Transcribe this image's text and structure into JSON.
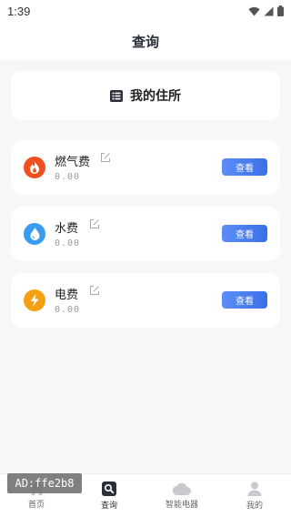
{
  "status_bar": {
    "time": "1:39",
    "icons": [
      "wifi-icon",
      "signal-icon",
      "battery-icon"
    ]
  },
  "header": {
    "title": "查询"
  },
  "residence": {
    "label": "我的住所",
    "icon": "list-icon"
  },
  "utilities": [
    {
      "name": "燃气费",
      "value": "0.00",
      "button_label": "查看",
      "icon": "flame-icon",
      "color": "#f0501e"
    },
    {
      "name": "水费",
      "value": "0.00",
      "button_label": "查看",
      "icon": "water-drop-icon",
      "color": "#3a9cf0"
    },
    {
      "name": "电费",
      "value": "0.00",
      "button_label": "查看",
      "icon": "lightning-icon",
      "color": "#f5a011"
    }
  ],
  "tab_bar": {
    "items": [
      {
        "label": "首页",
        "icon": "home-icon",
        "active": false
      },
      {
        "label": "查询",
        "icon": "search-icon",
        "active": true
      },
      {
        "label": "智能电器",
        "icon": "cloud-icon",
        "active": false
      },
      {
        "label": "我的",
        "icon": "profile-icon",
        "active": false
      }
    ]
  },
  "ad_badge": {
    "text": "AD:ffe2b8"
  },
  "colors": {
    "accent": "#3b6fe6",
    "background": "#f6f7f9",
    "card": "#ffffff"
  }
}
